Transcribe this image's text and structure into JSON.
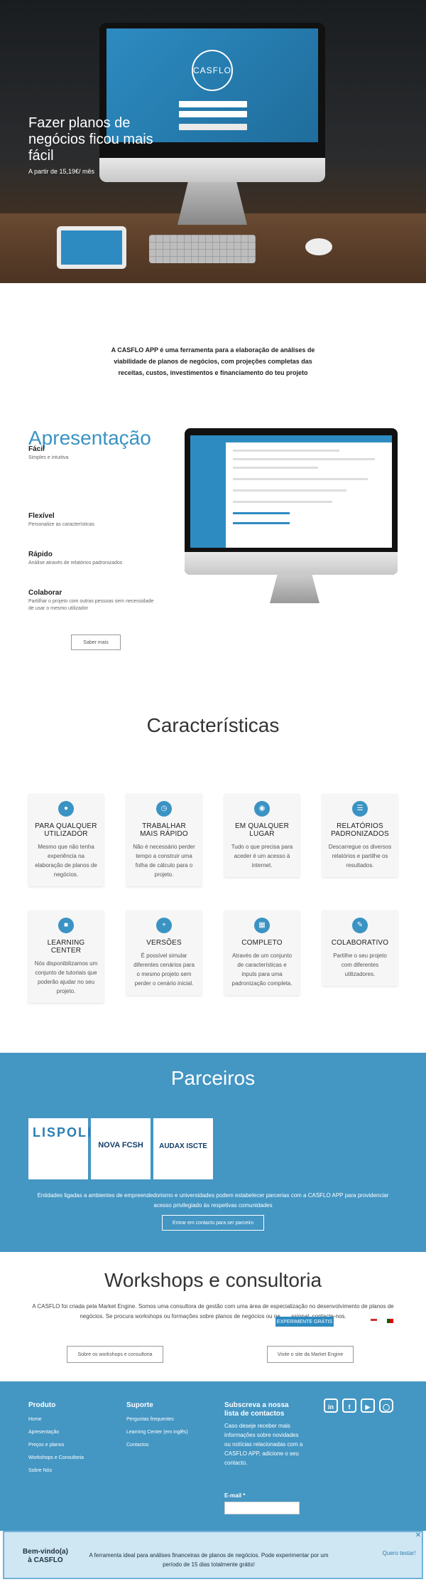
{
  "hero": {
    "title": "Fazer planos de negócios ficou mais fácil",
    "price": "A partir de 15,19€/ mês",
    "screen_logo": "CASFLO"
  },
  "intro": {
    "text": "A CASFLO APP é uma ferramenta para a elaboração de análises de viabilidade de planos de negócios, com projeções completas das receitas, custos, investimentos e financiamento do teu projeto"
  },
  "apresentacao": {
    "title": "Apresentação",
    "features": [
      {
        "title": "Fácil",
        "desc": "Simples e intuitiva"
      },
      {
        "title": "Flexível",
        "desc": "Personalize as características"
      },
      {
        "title": "Rápido",
        "desc": "Análise através de relatórios padronizados"
      },
      {
        "title": "Colaborar",
        "desc": "Partilhar o projeto com outras pessoas sem necessidade de usar o mesmo utilizador"
      }
    ],
    "button": "Saber mais"
  },
  "caracteristicas": {
    "title": "Características",
    "cards": [
      {
        "title": "PARA QUALQUER UTILIZADOR",
        "desc": "Mesmo que não tenha experiência na elaboração de planos de negócios.",
        "icon": "users-icon"
      },
      {
        "title": "TRABALHAR MAIS RÁPIDO",
        "desc": "Não é necessário perder tempo a construir uma folha de cálculo para o projeto.",
        "icon": "clock-icon"
      },
      {
        "title": "EM QUALQUER LUGAR",
        "desc": "Tudo o que precisa para aceder é um acesso à internet.",
        "icon": "globe-icon"
      },
      {
        "title": "RELATÓRIOS PADRONIZADOS",
        "desc": "Descarregue os diversos relatórios e partilhe os resultados.",
        "icon": "report-icon"
      },
      {
        "title": "LEARNING CENTER",
        "desc": "Nós disponibilizamos um conjunto de tutoriais que poderão ajudar no seu projeto.",
        "icon": "book-icon"
      },
      {
        "title": "VERSÕES",
        "desc": "É possível simular diferentes cenários para o mesmo projeto sem perder o cenário inicial.",
        "icon": "plus-icon"
      },
      {
        "title": "COMPLETO",
        "desc": "Através de um conjunto de características e inputs para uma padronização completa.",
        "icon": "keyboard-icon"
      },
      {
        "title": "COLABORATIVO",
        "desc": "Partilhe o seu projeto com diferentes utilizadores.",
        "icon": "pencil-icon"
      }
    ]
  },
  "parceiros": {
    "title": "Parceiros",
    "logos": [
      "LISPOLIS",
      "NOVA FCSH",
      "AUDAX ISCTE"
    ],
    "text": "Entidades ligadas a ambientes de empreendedorismo e universidades podem estabelecer parcerias com a CASFLO APP para providenciar acesso privilegiado às respetivas comunidades",
    "button": "Entrar em contacto para ser parceiro"
  },
  "workshops": {
    "title": "Workshops e consultoria",
    "text": "A CASFLO foi criada pela Market Engine. Somos uma consultora de gestão com uma área de especialização no desenvolvimento de planos de negócios. Se procura workshops ou formações sobre planos de negócios ou ne... ...ssional, contacte-nos.",
    "try_button": "EXPERIMENTE GRÁTIS",
    "button_left": "Sobre os workshops e consultoria",
    "button_right": "Visite o site da Market Engine"
  },
  "footer": {
    "produto": {
      "title": "Produto",
      "links": [
        "Home",
        "Apresentação",
        "Preços e planos",
        "Workshops e Consultoria",
        "Sobre Nós"
      ]
    },
    "suporte": {
      "title": "Suporte",
      "links": [
        "Perguntas frequentes",
        "Learning Center (em inglês)",
        "Contactos"
      ]
    },
    "newsletter": {
      "title": "Subscreva a nossa lista de contactos",
      "text": "Caso deseje receber mais informações sobre novidades ou notícias relacionadas com a CASFLO APP, adicione o seu contacto.",
      "email_label": "E-mail *"
    },
    "social": [
      "linkedin-icon",
      "facebook-icon",
      "youtube-icon",
      "instagram-icon"
    ]
  },
  "banner": {
    "welcome": "Bem-vindo(a) à CASFLO",
    "text": "A ferramenta ideal para análises financeiras de planos de negócios. Pode experimentar por um período de 15 dias totalmente grátis!",
    "cta": "Quero testar!",
    "close": "✕"
  },
  "colors": {
    "accent": "#4496c3",
    "brand_blue": "#2d8bc1"
  }
}
